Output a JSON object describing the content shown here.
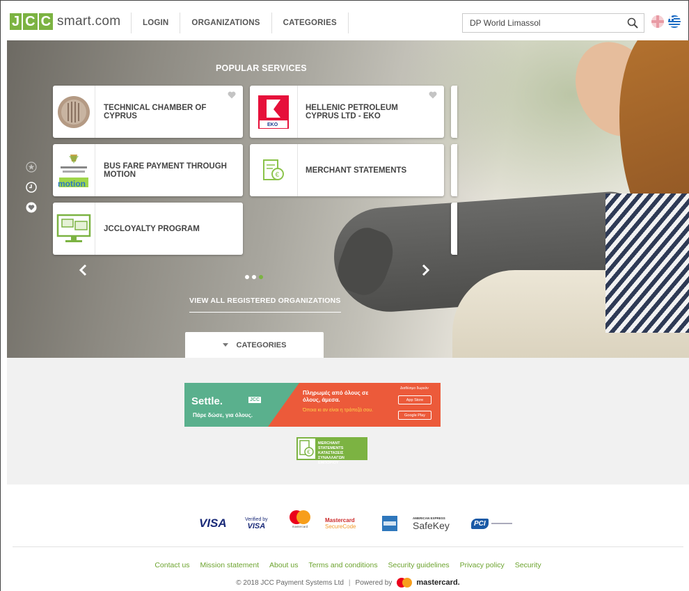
{
  "header": {
    "logo_box": "JCC",
    "logo_text": "smart.com",
    "nav": [
      "LOGIN",
      "ORGANIZATIONS",
      "CATEGORIES"
    ],
    "search_value": "DP World Limassol"
  },
  "hero": {
    "section_title": "POPULAR SERVICES",
    "cards": [
      {
        "label": "TECHNICAL CHAMBER OF CYPRUS",
        "icon": "technical-chamber-logo"
      },
      {
        "label": "HELLENIC PETROLEUM CYPRUS LTD - EKO",
        "icon": "eko-logo",
        "icon_text": "EKO"
      },
      {
        "label": "BUS FARE PAYMENT THROUGH MOTION",
        "icon": "motion-logo",
        "icon_text": "motion"
      },
      {
        "label": "MERCHANT STATEMENTS",
        "icon": "euro-document-icon"
      },
      {
        "label": "JCCLOYALTY PROGRAM",
        "icon": "loyalty-screen-icon"
      }
    ],
    "view_all": "VIEW ALL REGISTERED ORGANIZATIONS",
    "categories_tab": "CATEGORIES",
    "carousel_active_dot": 3,
    "carousel_dot_count": 3
  },
  "banner": {
    "settle": "Settle.",
    "settle_sub": "Πάρε δώσε, για όλους.",
    "jcc_tag": "JCC",
    "greek_main": "Πληρωμές από όλους σε όλους, άμεσα.",
    "greek_sub": "Όποια κι αν είναι η τράπεζά σου.",
    "available": "Διαθέσιμο δωρεάν",
    "app_store": "App Store",
    "google_play": "Google Play",
    "merchant_banner": "MERCHANT STATEMENTS ΚΑΤΑΣΤΑΣΕΙΣ ΣΥΝΑΛΛΑΓΩΝ ΕΜΠΟΡΙΟΥ"
  },
  "footer": {
    "payment_logos": [
      "VISA",
      "Verified by VISA",
      "mastercard",
      "Mastercard SecureCode",
      "American Express",
      "SafeKey",
      "PCI"
    ],
    "verified_by": "Verified by",
    "visa": "VISA",
    "mc_small": "mastercard",
    "mc_sc1": "Mastercard",
    "mc_sc2": "SecureCode",
    "amex_small": "AMERICAN EXPRESS",
    "safekey": "SafeKey",
    "pci": "PCI",
    "links": [
      "Contact us",
      "Mission statement",
      "About us",
      "Terms and conditions",
      "Security guidelines",
      "Privacy policy",
      "Security"
    ],
    "copyright": "© 2018 JCC Payment Systems Ltd",
    "sep": "|",
    "powered_by": "Powered by",
    "powered_brand": "mastercard."
  },
  "colors": {
    "brand_green": "#7cb342",
    "link_green": "#6ca32e",
    "settle_green": "#5ab08d",
    "settle_red": "#ec5a3a"
  }
}
